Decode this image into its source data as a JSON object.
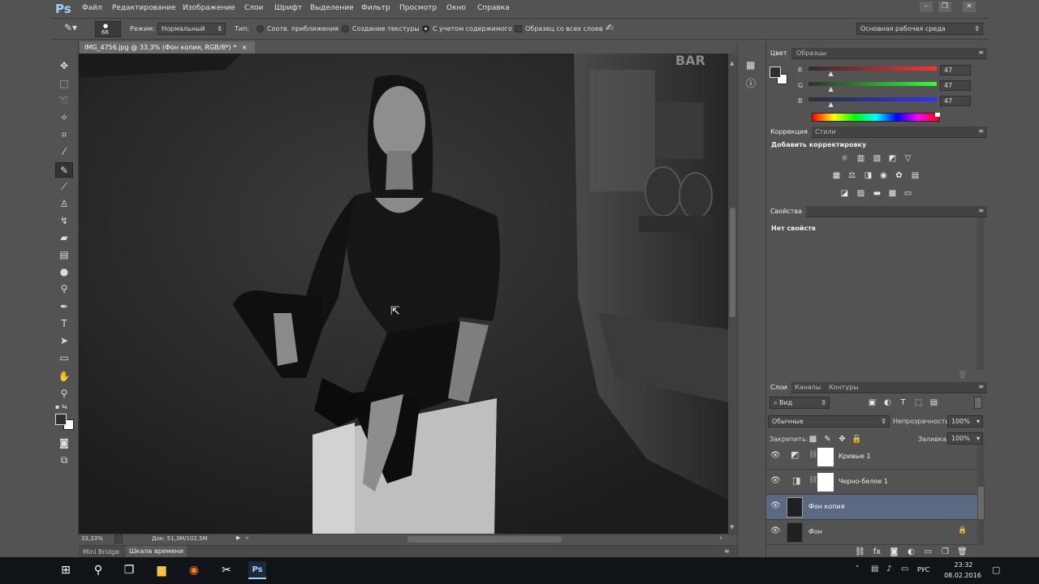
{
  "app": {
    "logo": "Ps"
  },
  "menu": [
    "Файл",
    "Редактирование",
    "Изображение",
    "Слои",
    "Шрифт",
    "Выделение",
    "Фильтр",
    "Просмотр",
    "Окно",
    "Справка"
  ],
  "options": {
    "brush_size": "66",
    "mode_label": "Режим:",
    "mode_value": "Нормальный",
    "type_label": "Тип:",
    "radio1": "Соотв. приближения",
    "radio2": "Создание текстуры",
    "radio3": "С учетом содержимого",
    "checkbox": "Образец со всех слоев",
    "workspace": "Основная рабочая среда"
  },
  "document": {
    "tab_title": "IMG_4756.jpg @ 33,3% (Фон копия, RGB/8*) *",
    "close": "×"
  },
  "status": {
    "zoom": "33,33%",
    "doc_info": "Док: 51,3M/102,5M"
  },
  "bottom_tabs": [
    "Mini Bridge",
    "Шкала времени"
  ],
  "color_panel": {
    "tabs": [
      "Цвет",
      "Образцы"
    ],
    "r_label": "R",
    "g_label": "G",
    "b_label": "B",
    "r": "47",
    "g": "47",
    "b": "47",
    "r_level": 0.18,
    "g_level": 0.18,
    "b_level": 0.18
  },
  "adjust_panel": {
    "tabs": [
      "Коррекция",
      "Стили"
    ],
    "title": "Добавить корректировку"
  },
  "props_panel": {
    "tab": "Свойства",
    "text": "Нет свойств"
  },
  "layers_panel": {
    "tabs": [
      "Слои",
      "Каналы",
      "Контуры"
    ],
    "filter": "Вид",
    "blend": "Обычные",
    "opacity_label": "Непрозрачность:",
    "opacity": "100%",
    "lock_label": "Закрепить:",
    "fill_label": "Заливка:",
    "fill": "100%",
    "layers": [
      {
        "name": "Кривые 1",
        "selected": false
      },
      {
        "name": "Черно-белое 1",
        "selected": false
      },
      {
        "name": "Фон копия",
        "selected": true
      },
      {
        "name": "Фон",
        "selected": false
      }
    ]
  },
  "taskbar": {
    "lang": "РУС",
    "time": "23:32",
    "date": "08.02.2016"
  },
  "colors": {
    "selected_layer": "#5b6a80",
    "panel_bg": "#535353",
    "accent": "#9fd0ff"
  }
}
